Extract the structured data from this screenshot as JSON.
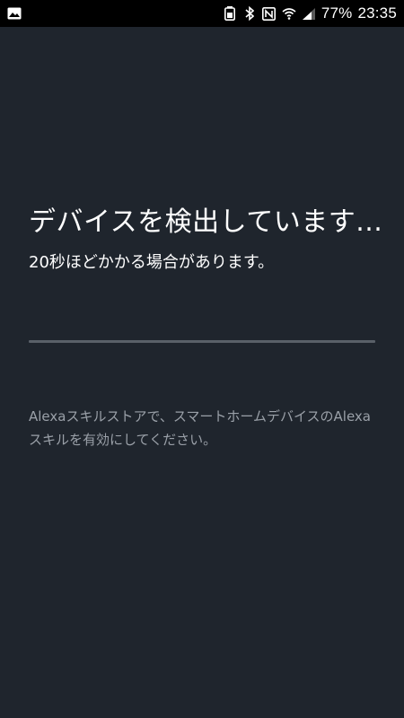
{
  "status_bar": {
    "left_icons": [
      "gallery-notification-icon"
    ],
    "right_icons": [
      "battery-saver-icon",
      "bluetooth-icon",
      "nfc-icon",
      "wifi-icon",
      "signal-icon"
    ],
    "battery_percent": "77%",
    "time": "23:35"
  },
  "main": {
    "title": "デバイスを検出しています...",
    "subtitle": "20秒ほどかかる場合があります。",
    "progress_fraction": 0,
    "hint": "Alexaスキルストアで、スマートホームデバイスのAlexaスキルを有効にしてください。"
  },
  "colors": {
    "background": "#1f252d",
    "status_bar": "#000000",
    "progress_track": "#596068",
    "hint_text": "#9aa0a8"
  }
}
